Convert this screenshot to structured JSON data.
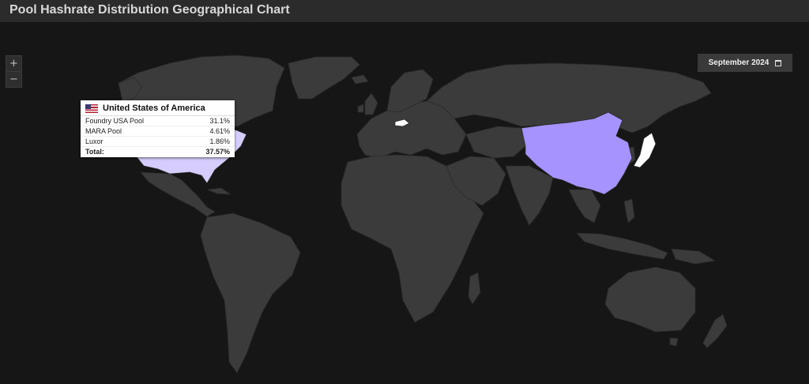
{
  "header": {
    "title": "Pool Hashrate Distribution Geographical Chart"
  },
  "controls": {
    "zoom_in": "+",
    "zoom_out": "−",
    "date_label": "September 2024",
    "date_icon": "calendar-icon"
  },
  "tooltip": {
    "country": "United States of America",
    "flag_icon": "us-flag-icon",
    "rows": [
      {
        "pool": "Foundry USA Pool",
        "value": "31.1%"
      },
      {
        "pool": "MARA Pool",
        "value": "4.61%"
      },
      {
        "pool": "Luxor",
        "value": "1.86%"
      }
    ],
    "total_label": "Total:",
    "total_value": "37.57%"
  },
  "legend": {
    "min": "0",
    "max": "100",
    "color_min": "#ffffff",
    "color_max": "#8a72ff"
  },
  "highlighted_countries": [
    {
      "name": "United States of America",
      "color": "#d6cdfd"
    },
    {
      "name": "China",
      "color": "#a693fe"
    },
    {
      "name": "Japan",
      "color": "#ffffff"
    },
    {
      "name": "Czech Republic",
      "color": "#ffffff"
    }
  ],
  "colors": {
    "land": "#3b3b3b",
    "borders": "#2a2a2a",
    "ocean": "#161616"
  }
}
